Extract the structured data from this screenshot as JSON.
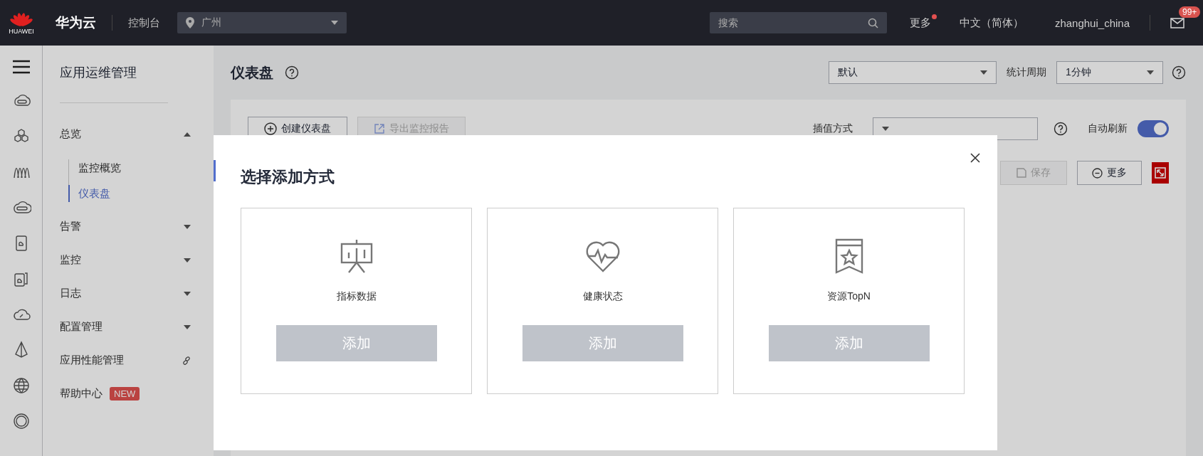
{
  "topbar": {
    "logo_text": "HUAWEI",
    "brand": "华为云",
    "console": "控制台",
    "region": "广州",
    "search_placeholder": "搜索",
    "more": "更多",
    "more_has_dot": true,
    "language": "中文（简体）",
    "user": "zhanghui_china",
    "mail_badge": "99+"
  },
  "sidebar": {
    "title": "应用运维管理",
    "items": [
      {
        "kind": "group",
        "label": "总览",
        "expanded": true,
        "children": [
          {
            "label": "监控概览",
            "selected": false
          },
          {
            "label": "仪表盘",
            "selected": true
          }
        ]
      },
      {
        "kind": "group",
        "label": "告警",
        "expanded": false
      },
      {
        "kind": "group",
        "label": "监控",
        "expanded": false
      },
      {
        "kind": "group",
        "label": "日志",
        "expanded": false
      },
      {
        "kind": "group",
        "label": "配置管理",
        "expanded": false
      },
      {
        "kind": "link",
        "label": "应用性能管理"
      },
      {
        "kind": "badge",
        "label": "帮助中心",
        "badge": "NEW"
      }
    ]
  },
  "page": {
    "title": "仪表盘",
    "view_select": "默认",
    "period_label": "统计周期",
    "period_select": "1分钟",
    "toolbar": {
      "create_button": "创建仪表盘",
      "export_button": {
        "label": "导出监控报告",
        "disabled": true
      },
      "interp_label": "插值方式",
      "auto_refresh_label": "自动刷新",
      "auto_refresh_on": true,
      "save_button": {
        "label": "保存",
        "disabled": true
      },
      "more_button": "更多"
    }
  },
  "modal": {
    "title": "选择添加方式",
    "options": [
      {
        "kind": "metrics",
        "label": "指标数据",
        "button": "添加"
      },
      {
        "kind": "health",
        "label": "健康状态",
        "button": "添加"
      },
      {
        "kind": "topn",
        "label": "资源TopN",
        "button": "添加"
      }
    ]
  }
}
